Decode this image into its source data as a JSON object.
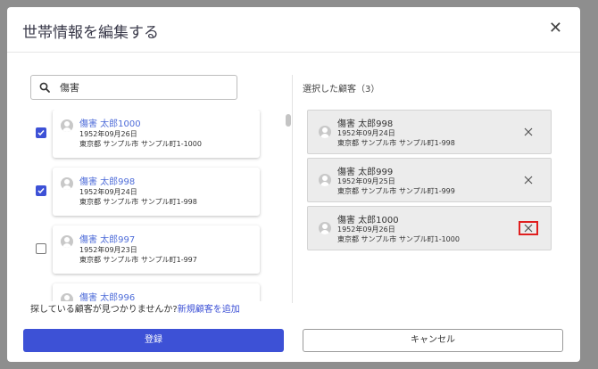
{
  "dialog": {
    "title": "世帯情報を編集する",
    "close_icon": "close-icon"
  },
  "search": {
    "value": "傷害",
    "icon": "search-icon"
  },
  "results": [
    {
      "checked": true,
      "name": "傷害 太郎1000",
      "birth": "1952年09月26日",
      "address": "東京都 サンプル市 サンプル町1-1000"
    },
    {
      "checked": true,
      "name": "傷害 太郎998",
      "birth": "1952年09月24日",
      "address": "東京都 サンプル市 サンプル町1-998"
    },
    {
      "checked": false,
      "name": "傷害 太郎997",
      "birth": "1952年09月23日",
      "address": "東京都 サンプル市 サンプル町1-997"
    },
    {
      "checked": false,
      "name": "傷害 太郎996",
      "birth": "",
      "address": ""
    }
  ],
  "not_found": {
    "text": "探している顧客が見つかりませんか?",
    "link": "新規顧客を追加"
  },
  "selected": {
    "header": "選択した顧客（3）",
    "items": [
      {
        "name": "傷害 太郎998",
        "birth": "1952年09月24日",
        "address": "東京都 サンプル市 サンプル町1-998"
      },
      {
        "name": "傷害 太郎999",
        "birth": "1952年09月25日",
        "address": "東京都 サンプル市 サンプル町1-999"
      },
      {
        "name": "傷害 太郎1000",
        "birth": "1952年09月26日",
        "address": "東京都 サンプル市 サンプル町1-1000"
      }
    ]
  },
  "footer": {
    "register_label": "登録",
    "cancel_label": "キャンセル"
  },
  "colors": {
    "accent": "#3d51d6",
    "link": "#4f6dd9",
    "highlight": "#e02020"
  }
}
